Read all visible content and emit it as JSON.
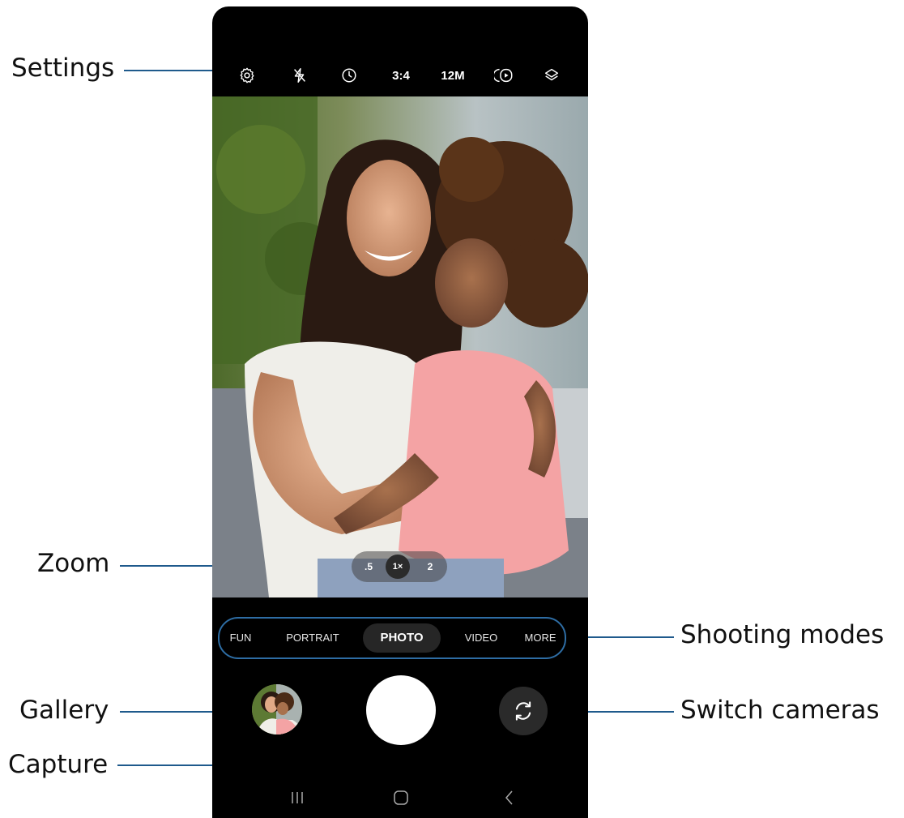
{
  "callouts": {
    "settings": "Settings",
    "zoom": "Zoom",
    "gallery": "Gallery",
    "capture": "Capture",
    "shooting_modes": "Shooting modes",
    "switch_cameras": "Switch cameras"
  },
  "toolbar": {
    "icons": [
      "gear-icon",
      "flash-off-icon",
      "timer-icon",
      "motion-photo-icon",
      "filters-icon"
    ],
    "ratio_label": "3:4",
    "resolution_label": "12M"
  },
  "zoom": {
    "options": [
      ".5",
      "1×",
      "2"
    ],
    "selected": "1×"
  },
  "modes": {
    "items": [
      "FUN",
      "PORTRAIT",
      "PHOTO",
      "VIDEO",
      "MORE"
    ],
    "selected": "PHOTO"
  },
  "colors": {
    "leader": "#1f5a8c",
    "mode_outline": "#2e6da4",
    "phone_bg": "#000000"
  }
}
